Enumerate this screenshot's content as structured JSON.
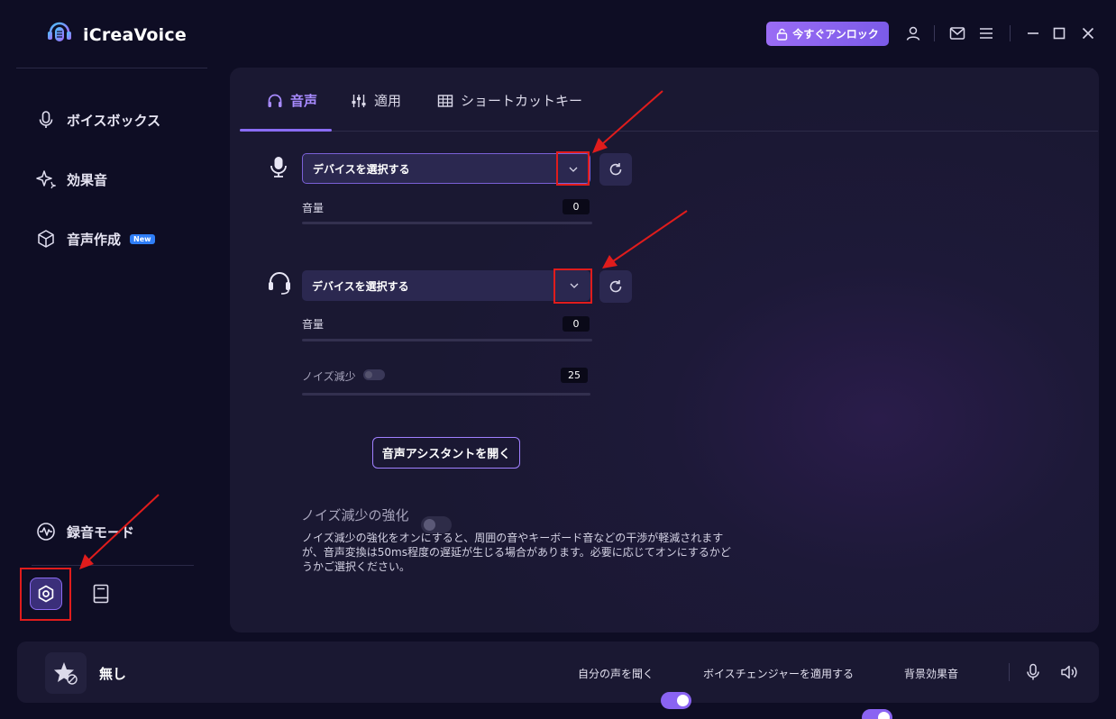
{
  "app": {
    "name": "iCreaVoice"
  },
  "titlebar": {
    "unlock_label": "今すぐアンロック",
    "icons": [
      "lock-icon",
      "user-icon",
      "mail-icon",
      "menu-icon",
      "minimize-icon",
      "maximize-icon",
      "close-icon"
    ]
  },
  "sidebar": {
    "items": [
      {
        "label": "ボイスボックス",
        "icon": "microphone-icon"
      },
      {
        "label": "効果音",
        "icon": "sparkle-icon"
      },
      {
        "label": "音声作成",
        "icon": "cube-icon",
        "badge": "New"
      },
      {
        "label": "録音モード",
        "icon": "waveform-icon"
      }
    ],
    "bottom_icons": [
      "settings-icon",
      "book-icon"
    ]
  },
  "tabs": [
    {
      "label": "音声",
      "icon": "headphones-icon",
      "active": true
    },
    {
      "label": "適用",
      "icon": "sliders-icon",
      "active": false
    },
    {
      "label": "ショートカットキー",
      "icon": "grid-icon",
      "active": false
    }
  ],
  "input_device": {
    "select_placeholder": "デバイスを選択する",
    "volume_label": "音量",
    "volume_value": "0"
  },
  "output_device": {
    "select_placeholder": "デバイスを選択する",
    "volume_label": "音量",
    "volume_value": "0",
    "noise_label": "ノイズ減少",
    "noise_value": "25"
  },
  "assistant_button": "音声アシスタントを開く",
  "noise_enhance": {
    "label": "ノイズ減少の強化",
    "enabled": false,
    "description": "ノイズ減少の強化をオンにすると、周囲の音やキーボード音などの干渉が軽減されますが、音声変換は50ms程度の遅延が生じる場合があります。必要に応じてオンにするかどうかご選択ください。"
  },
  "bottombar": {
    "current_voice": "無し",
    "listen_label": "自分の声を聞く",
    "listen_on": true,
    "apply_changer_label": "ボイスチェンジャーを適用する",
    "apply_changer_on": true,
    "bg_sound_label": "背景効果音",
    "bg_sound_on": false
  },
  "colors": {
    "accent": "#8a63f2",
    "background": "#0e0d24",
    "panel": "#1d1938",
    "annotation_red": "#e01c1c"
  }
}
